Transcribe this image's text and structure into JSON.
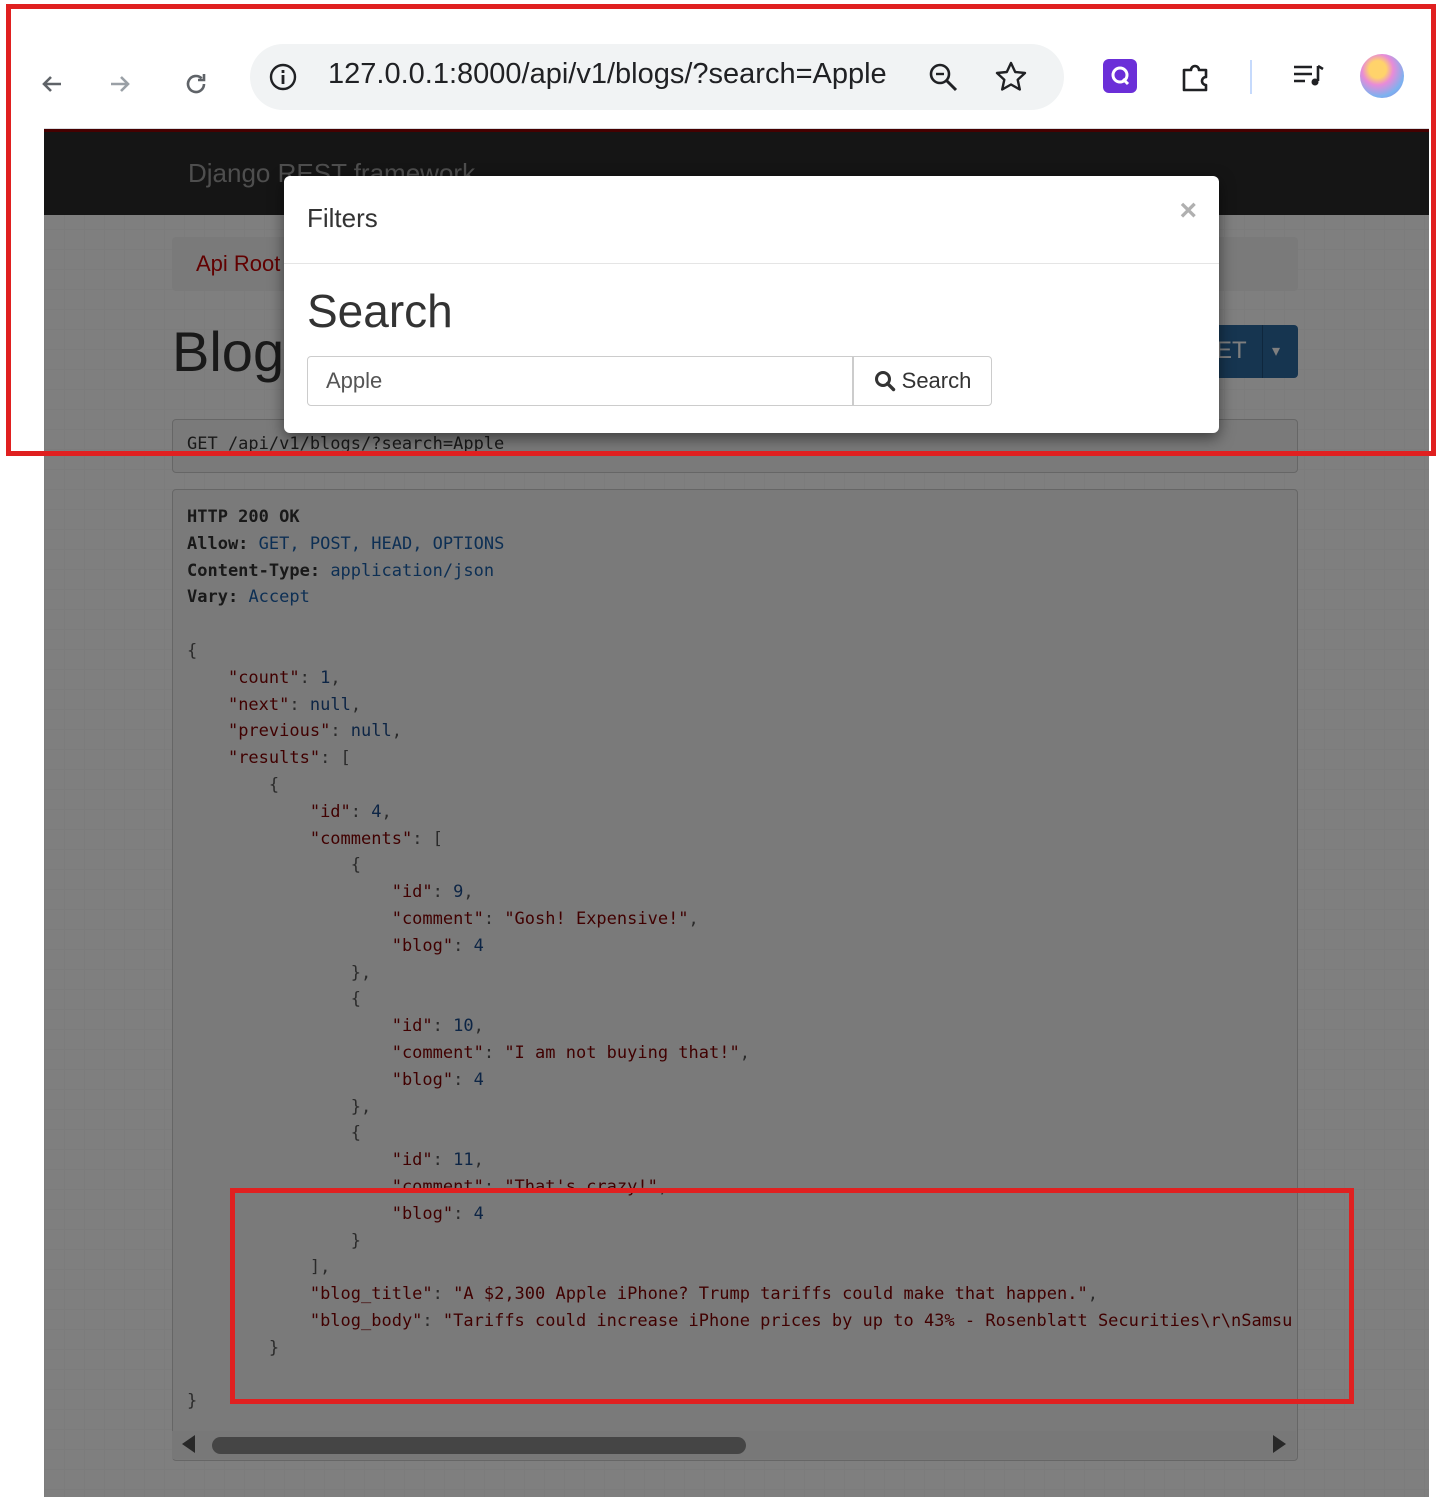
{
  "browser": {
    "url": "127.0.0.1:8000/api/v1/blogs/?search=Apple"
  },
  "app": {
    "brand": "Django REST framework",
    "breadcrumb": "Api Root",
    "page_title": "Blog",
    "get_button": "ET"
  },
  "request_line": "GET /api/v1/blogs/?search=Apple",
  "response": {
    "status": "HTTP 200 OK",
    "headers": [
      {
        "name": "Allow:",
        "value": "GET, POST, HEAD, OPTIONS"
      },
      {
        "name": "Content-Type:",
        "value": "application/json"
      },
      {
        "name": "Vary:",
        "value": "Accept"
      }
    ],
    "count": "1",
    "next": "null",
    "previous": "null",
    "result": {
      "id": "4",
      "comments": [
        {
          "id": "9",
          "comment": "\"Gosh! Expensive!\"",
          "blog": "4"
        },
        {
          "id": "10",
          "comment": "\"I am not buying that!\"",
          "blog": "4"
        },
        {
          "id": "11",
          "comment": "\"That's crazy!\"",
          "blog": "4"
        }
      ],
      "blog_title": "\"A $2,300 Apple iPhone? Trump tariffs could make that happen.\"",
      "blog_body": "\"Tariffs could increase iPhone prices by up to 43% - Rosenblatt Securities\\r\\nSamsu"
    }
  },
  "modal": {
    "title": "Filters",
    "close": "×",
    "search_heading": "Search",
    "search_value": "Apple",
    "search_button": "Search"
  },
  "colors": {
    "annotation": "#e02020",
    "navbar": "#2b2b2b",
    "breadcrumb_link": "#c20000"
  }
}
